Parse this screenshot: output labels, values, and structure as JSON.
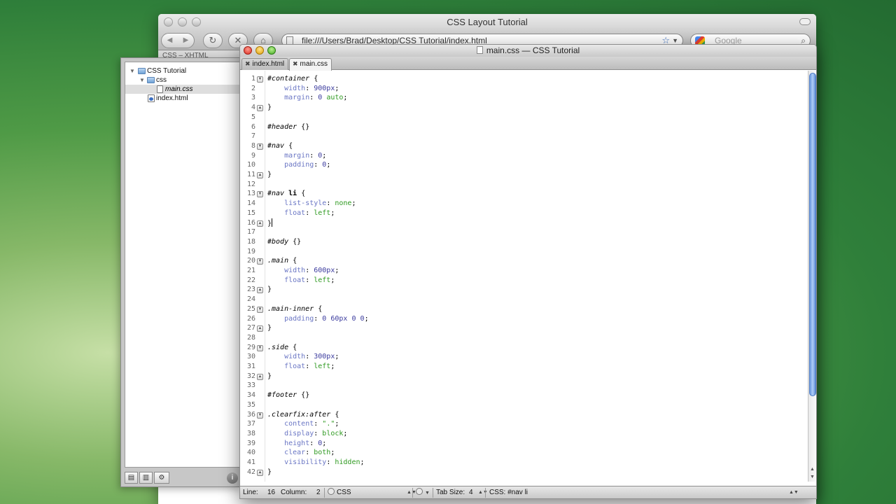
{
  "browser": {
    "title": "CSS Layout Tutorial",
    "url": "file:///Users/Brad/Desktop/CSS Tutorial/index.html",
    "search_placeholder": "Google",
    "bookmarks_fragment": "CSS – XHTML"
  },
  "project": {
    "items": [
      {
        "label": "CSS Tutorial",
        "type": "folder",
        "level": 0,
        "expanded": true
      },
      {
        "label": "css",
        "type": "folder",
        "level": 1,
        "expanded": true
      },
      {
        "label": "main.css",
        "type": "file",
        "level": 2,
        "selected": true
      },
      {
        "label": "index.html",
        "type": "html",
        "level": 1
      }
    ]
  },
  "editor": {
    "title": "main.css — CSS Tutorial",
    "tabs": [
      {
        "label": "index.html",
        "active": false
      },
      {
        "label": "main.css",
        "active": true
      }
    ],
    "lines": [
      "#container {",
      "    width: 900px;",
      "    margin: 0 auto;",
      "}",
      "",
      "#header {}",
      "",
      "#nav {",
      "    margin: 0;",
      "    padding: 0;",
      "}",
      "",
      "#nav li {",
      "    list-style: none;",
      "    float: left;",
      "}",
      "",
      "#body {}",
      "",
      ".main {",
      "    width: 600px;",
      "    float: left;",
      "}",
      "",
      ".main-inner {",
      "    padding: 0 60px 0 0;",
      "}",
      "",
      ".side {",
      "    width: 300px;",
      "    float: left;",
      "}",
      "",
      "#footer {}",
      "",
      ".clearfix:after {",
      "    content: \".\";",
      "    display: block;",
      "    height: 0;",
      "    clear: both;",
      "    visibility: hidden;",
      "}"
    ],
    "fold_open_lines": [
      1,
      8,
      13,
      20,
      25,
      29,
      36
    ],
    "fold_close_lines": [
      4,
      11,
      16,
      23,
      27,
      32,
      42
    ],
    "cursor_line": 16
  },
  "status": {
    "line_label": "Line:",
    "line_value": "16",
    "column_label": "Column:",
    "column_value": "2",
    "language": "CSS",
    "tab_size_label": "Tab Size:",
    "tab_size_value": "4",
    "scope": "CSS: #nav li"
  }
}
